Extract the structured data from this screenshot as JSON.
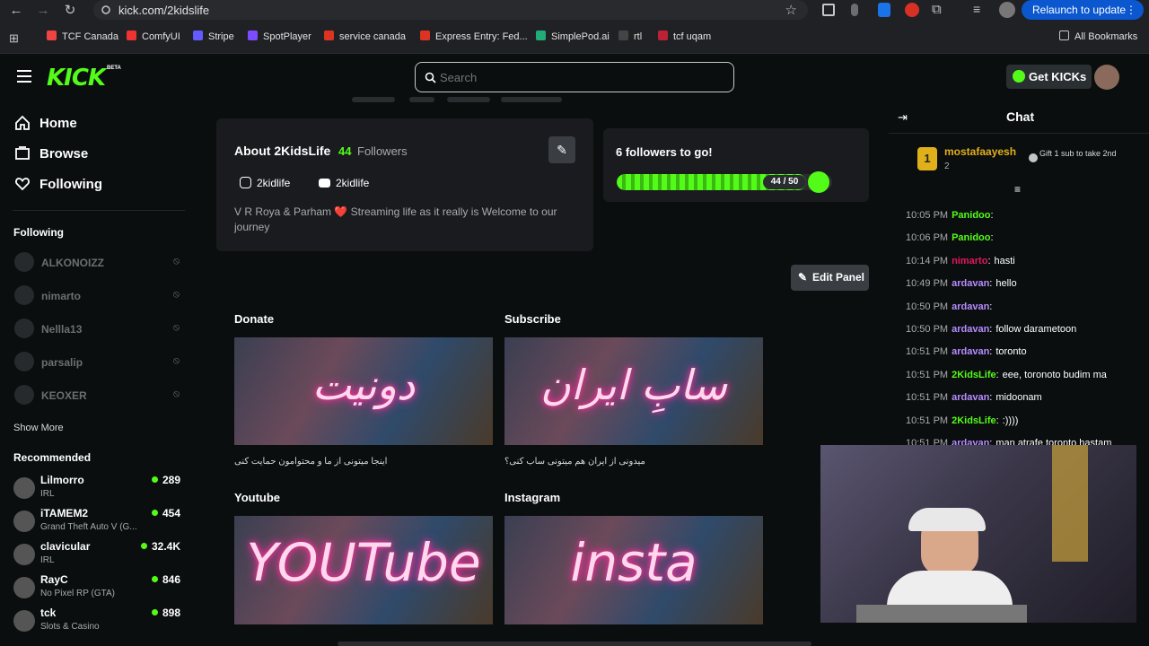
{
  "browser": {
    "url": "kick.com/2kidslife",
    "relaunch": "Relaunch to update",
    "bookmarks": [
      {
        "label": "TCF Canada",
        "color": "#e44"
      },
      {
        "label": "ComfyUI",
        "color": "#e33"
      },
      {
        "label": "Stripe",
        "color": "#635bff"
      },
      {
        "label": "SpotPlayer",
        "color": "#7b4dff"
      },
      {
        "label": "service canada",
        "color": "#d32"
      },
      {
        "label": "Express Entry: Fed...",
        "color": "#d32"
      },
      {
        "label": "SimplePod.ai",
        "color": "#2a7"
      },
      {
        "label": "rtl",
        "color": "#444"
      },
      {
        "label": "tcf uqam",
        "color": "#b23"
      }
    ],
    "all_bookmarks": "All Bookmarks"
  },
  "header": {
    "logo": "KICK",
    "beta": "BETA",
    "search_placeholder": "Search",
    "get_kicks": "Get KICKs"
  },
  "sidebar": {
    "nav": [
      {
        "label": "Home",
        "icon": "home-icon"
      },
      {
        "label": "Browse",
        "icon": "browse-icon"
      },
      {
        "label": "Following",
        "icon": "heart-icon"
      }
    ],
    "following_title": "Following",
    "following": [
      "ALKONOIZZ",
      "nimarto",
      "Nellla13",
      "parsalip",
      "KEOXER"
    ],
    "show_more": "Show More",
    "recommended_title": "Recommended",
    "recommended": [
      {
        "name": "Lilmorro",
        "category": "IRL",
        "viewers": "289"
      },
      {
        "name": "iTAMEM2",
        "category": "Grand Theft Auto V (G...",
        "viewers": "454"
      },
      {
        "name": "clavicular",
        "category": "IRL",
        "viewers": "32.4K"
      },
      {
        "name": "RayC",
        "category": "No Pixel RP (GTA)",
        "viewers": "846"
      },
      {
        "name": "tck",
        "category": "Slots & Casino",
        "viewers": "898"
      }
    ]
  },
  "about": {
    "title": "About 2KidsLife",
    "followers_count": "44",
    "followers_label": "Followers",
    "instagram": "2kidlife",
    "youtube": "2kidlife",
    "bio": "V R Roya & Parham ❤️ Streaming life as it really is Welcome to our journey"
  },
  "goal": {
    "title": "6 followers to go!",
    "progress_text": "44 / 50",
    "progress_fraction": 0.88
  },
  "edit_panel": "Edit Panel",
  "panels": [
    {
      "title": "Donate",
      "art_text": "دونیت",
      "caption": "اینجا میتونی از ما و محتوامون حمایت کنی"
    },
    {
      "title": "Subscribe",
      "art_text": "سابِ ایران",
      "caption": "میدونی از ایران هم میتونی ساب کنی؟"
    },
    {
      "title": "Youtube",
      "art_text": "YOUTube",
      "caption": ""
    },
    {
      "title": "Instagram",
      "art_text": "insta",
      "caption": ""
    }
  ],
  "chat": {
    "title": "Chat",
    "pinned_user": "mostafaayesh",
    "pinned_count": "2",
    "gift_text": "Gift 1 sub to take 2nd",
    "messages": [
      {
        "time": "10:05 PM",
        "user": "Panidoo",
        "sep": ":",
        "text": "",
        "color": "#53fc18"
      },
      {
        "time": "10:06 PM",
        "user": "Panidoo",
        "sep": ":",
        "text": "",
        "color": "#53fc18"
      },
      {
        "time": "10:14 PM",
        "user": "nimarto",
        "sep": ":",
        "text": "hasti",
        "color": "#e0195a"
      },
      {
        "time": "10:49 PM",
        "user": "ardavan",
        "sep": ":",
        "text": "hello",
        "color": "#b58cff"
      },
      {
        "time": "10:50 PM",
        "user": "ardavan",
        "sep": ":",
        "text": "",
        "color": "#b58cff"
      },
      {
        "time": "10:50 PM",
        "user": "ardavan",
        "sep": ":",
        "text": "follow darametoon",
        "color": "#b58cff"
      },
      {
        "time": "10:51 PM",
        "user": "ardavan",
        "sep": ":",
        "text": "toronto",
        "color": "#b58cff"
      },
      {
        "time": "10:51 PM",
        "user": "2KidsLife",
        "sep": ":",
        "text": "eee, toronoto budim ma",
        "color": "#53fc18"
      },
      {
        "time": "10:51 PM",
        "user": "ardavan",
        "sep": ":",
        "text": "midoonam",
        "color": "#b58cff"
      },
      {
        "time": "10:51 PM",
        "user": "2KidsLife",
        "sep": ":",
        "text": ":))))",
        "color": "#53fc18"
      },
      {
        "time": "10:51 PM",
        "user": "ardavan",
        "sep": ":",
        "text": "man atrafe toronto hastam",
        "color": "#b58cff"
      }
    ]
  }
}
